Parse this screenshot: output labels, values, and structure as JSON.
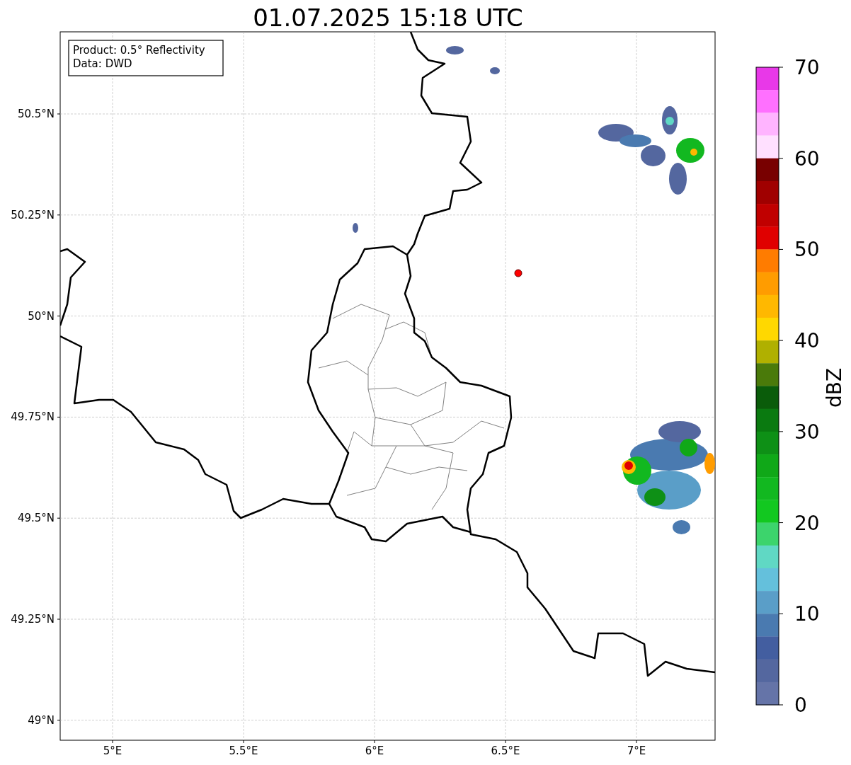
{
  "title": "01.07.2025 15:18 UTC",
  "info_box": [
    "Product: 0.5° Reflectivity",
    "Data: DWD"
  ],
  "x_ticks": [
    "5°E",
    "5.5°E",
    "6°E",
    "6.5°E",
    "7°E"
  ],
  "y_ticks": [
    "50.5°N",
    "50.25°N",
    "50°N",
    "49.75°N",
    "49.5°N",
    "49.25°N",
    "49°N"
  ],
  "colorbar": {
    "label": "dBZ",
    "ticks": [
      "70",
      "60",
      "50",
      "40",
      "30",
      "20",
      "10",
      "0"
    ],
    "segments": [
      {
        "color": "#e838e8"
      },
      {
        "color": "#ff70ff"
      },
      {
        "color": "#ffb4ff"
      },
      {
        "color": "#ffe0ff"
      },
      {
        "color": "#780000"
      },
      {
        "color": "#a00000"
      },
      {
        "color": "#c00000"
      },
      {
        "color": "#e00000"
      },
      {
        "color": "#ff7c00"
      },
      {
        "color": "#ff9c00"
      },
      {
        "color": "#ffb800"
      },
      {
        "color": "#ffd800"
      },
      {
        "color": "#b0b000"
      },
      {
        "color": "#4a7a0a"
      },
      {
        "color": "#0a5c0a"
      },
      {
        "color": "#0a7a10"
      },
      {
        "color": "#0e9016"
      },
      {
        "color": "#10a818"
      },
      {
        "color": "#12b820"
      },
      {
        "color": "#12c820"
      },
      {
        "color": "#3cd46c"
      },
      {
        "color": "#60d8c4"
      },
      {
        "color": "#64c0dc"
      },
      {
        "color": "#5a9ec8"
      },
      {
        "color": "#4a7ab0"
      },
      {
        "color": "#435ea0"
      },
      {
        "color": "#54679f"
      },
      {
        "color": "#6574a8"
      }
    ]
  }
}
